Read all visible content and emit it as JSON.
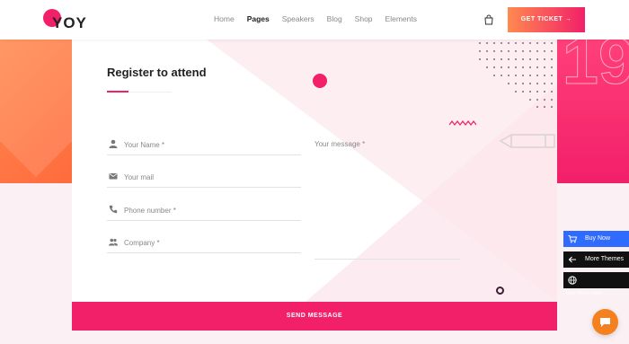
{
  "brand": {
    "logo_text": "YOY",
    "accent": "#f21f69",
    "accent_orange": "#ff8a4f"
  },
  "nav": {
    "items": [
      {
        "label": "Home"
      },
      {
        "label": "Pages"
      },
      {
        "label": "Speakers"
      },
      {
        "label": "Blog"
      },
      {
        "label": "Shop"
      },
      {
        "label": "Elements"
      }
    ],
    "active": "Pages",
    "cart_icon": "shopping-bag-icon",
    "ticket_label": "GET TICKET →"
  },
  "form": {
    "title": "Register to attend",
    "fields": [
      {
        "placeholder": "Your Name *",
        "icon": "user-icon"
      },
      {
        "placeholder": "Your mail",
        "icon": "mail-icon"
      },
      {
        "placeholder": "Phone number *",
        "icon": "phone-icon"
      },
      {
        "placeholder": "Company *",
        "icon": "users-icon"
      }
    ],
    "message_placeholder": "Your message *",
    "submit_label": "SEND MESSAGE"
  },
  "side": {
    "buy_now": "Buy Now",
    "more_themes": "More Themes",
    "buy_more_caption": "Buy More Here",
    "chat_icon": "chat-icon"
  }
}
